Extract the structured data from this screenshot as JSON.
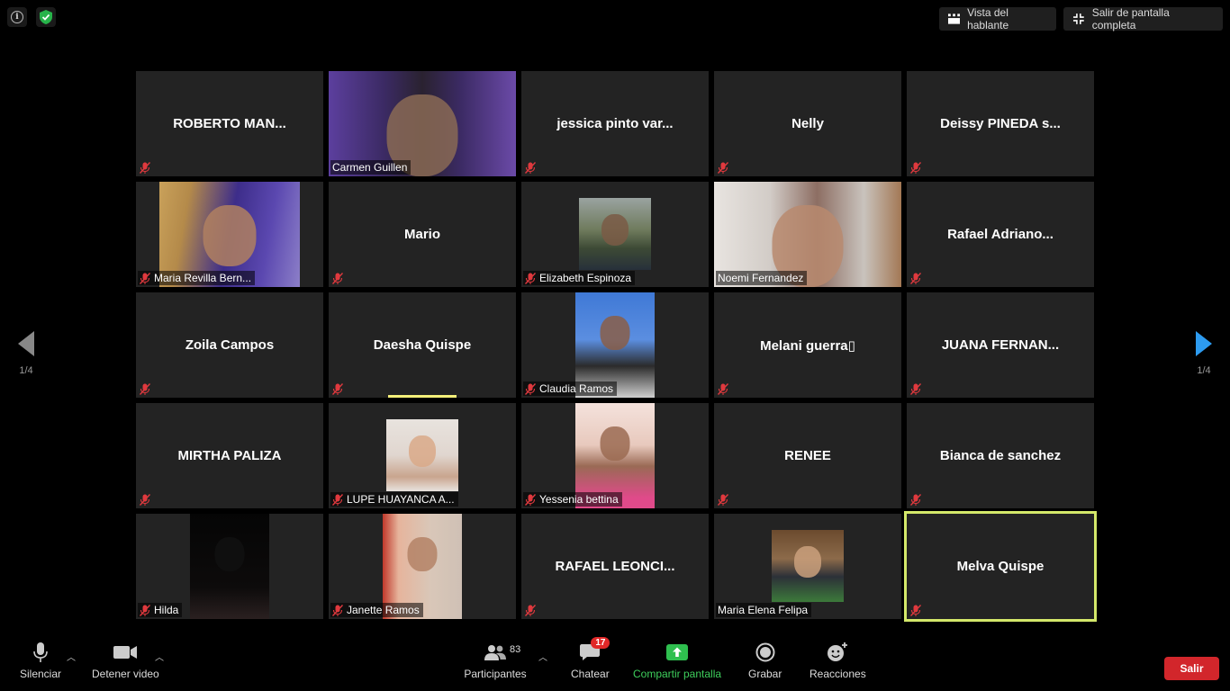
{
  "top": {
    "speaker_view": "Vista del hablante",
    "exit_fullscreen": "Salir de pantalla completa"
  },
  "nav": {
    "page_left": "1/4",
    "page_right": "1/4"
  },
  "tiles": [
    {
      "name": "ROBERTO  MAN...",
      "label": "",
      "video": false
    },
    {
      "name": "",
      "label": "Carmen Guillen",
      "video": true
    },
    {
      "name": "jessica  pinto  var...",
      "label": "",
      "video": false
    },
    {
      "name": "Nelly",
      "label": "",
      "video": false
    },
    {
      "name": "Deissy PINEDA s...",
      "label": "",
      "video": false
    },
    {
      "name": "",
      "label": "Maria Revilla Bern...",
      "video": true
    },
    {
      "name": "Mario",
      "label": "",
      "video": false
    },
    {
      "name": "",
      "label": "Elizabeth Espinoza",
      "video": true
    },
    {
      "name": "",
      "label": "Noemi Fernandez",
      "video": true
    },
    {
      "name": "Rafael  Adriano...",
      "label": "",
      "video": false
    },
    {
      "name": "Zoila Campos",
      "label": "",
      "video": false
    },
    {
      "name": "Daesha Quispe",
      "label": "",
      "video": false
    },
    {
      "name": "",
      "label": "Claudia Ramos",
      "video": true
    },
    {
      "name": "Melani  guerra▯",
      "label": "",
      "video": false
    },
    {
      "name": "JUANA FERNAN...",
      "label": "",
      "video": false
    },
    {
      "name": "MIRTHA PALIZA",
      "label": "",
      "video": false
    },
    {
      "name": "",
      "label": "LUPE HUAYANCA A...",
      "video": true
    },
    {
      "name": "",
      "label": "Yessenia bettina",
      "video": true
    },
    {
      "name": "RENEE",
      "label": "",
      "video": false
    },
    {
      "name": "Bianca de sanchez",
      "label": "",
      "video": false
    },
    {
      "name": "",
      "label": "Hilda",
      "video": true
    },
    {
      "name": "",
      "label": "Janette Ramos",
      "video": true
    },
    {
      "name": "RAFAEL  LEONCI...",
      "label": "",
      "video": false
    },
    {
      "name": "",
      "label": "Maria Elena Felipa",
      "video": true
    },
    {
      "name": "Melva Quispe",
      "label": "",
      "video": false
    }
  ],
  "toolbar": {
    "mute": "Silenciar",
    "stop_video": "Detener video",
    "participants": "Participantes",
    "participants_count": "83",
    "chat": "Chatear",
    "chat_badge": "17",
    "share": "Compartir pantalla",
    "record": "Grabar",
    "reactions": "Reacciones",
    "leave": "Salir"
  },
  "colors": {
    "tile_bg": "#232323",
    "active_border": "#d4e86a",
    "share_green": "#3ecf5c",
    "leave_red": "#d2262b",
    "mute_red": "#e0393e",
    "nav_blue": "#2d9bf0"
  }
}
